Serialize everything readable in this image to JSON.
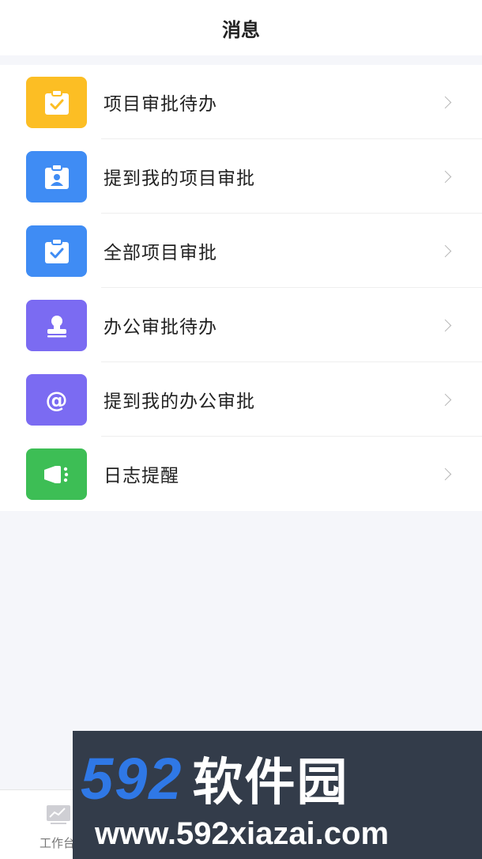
{
  "header": {
    "title": "消息"
  },
  "items": [
    {
      "label": "项目审批待办",
      "icon": "clipboard-check-icon",
      "color": "#FCBE24"
    },
    {
      "label": "提到我的项目审批",
      "icon": "clipboard-user-icon",
      "color": "#3F8CF4"
    },
    {
      "label": "全部项目审批",
      "icon": "clipboard-check-icon",
      "color": "#3F8CF4"
    },
    {
      "label": "办公审批待办",
      "icon": "stamp-icon",
      "color": "#7B6BF2"
    },
    {
      "label": "提到我的办公审批",
      "icon": "at-icon",
      "color": "#7B6BF2",
      "glyph": "@"
    },
    {
      "label": "日志提醒",
      "icon": "megaphone-icon",
      "color": "#3DBE55"
    }
  ],
  "tabbar": {
    "first_label": "工作台"
  },
  "watermark": {
    "number": "592",
    "name": "软件园",
    "url": "www.592xiazai.com"
  }
}
